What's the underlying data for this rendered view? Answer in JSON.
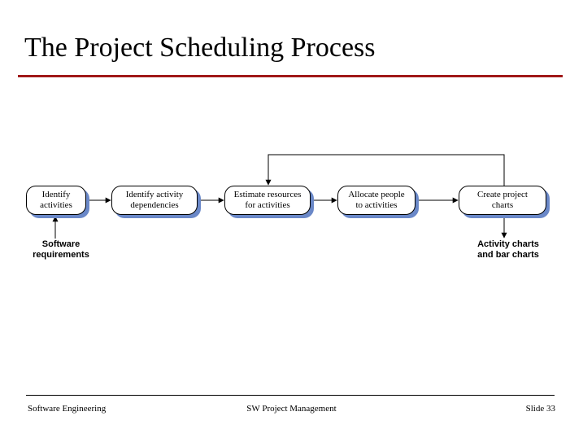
{
  "title": "The Project Scheduling Process",
  "boxes": {
    "b1": {
      "line1": "Identify",
      "line2": "activities"
    },
    "b2": {
      "line1": "Identify activity",
      "line2": "dependencies"
    },
    "b3": {
      "line1": "Estimate resources",
      "line2": "for activities"
    },
    "b4": {
      "line1": "Allocate people",
      "line2": "to activities"
    },
    "b5": {
      "line1": "Create project",
      "line2": "charts"
    }
  },
  "labels": {
    "sw_req": {
      "line1": "Software",
      "line2": "requirements"
    },
    "charts": {
      "line1": "Activity charts",
      "line2": "and bar charts"
    }
  },
  "footer": {
    "left": "Software Engineering",
    "center": "SW Project Management",
    "right_prefix": "Slide ",
    "right_num": "33"
  }
}
